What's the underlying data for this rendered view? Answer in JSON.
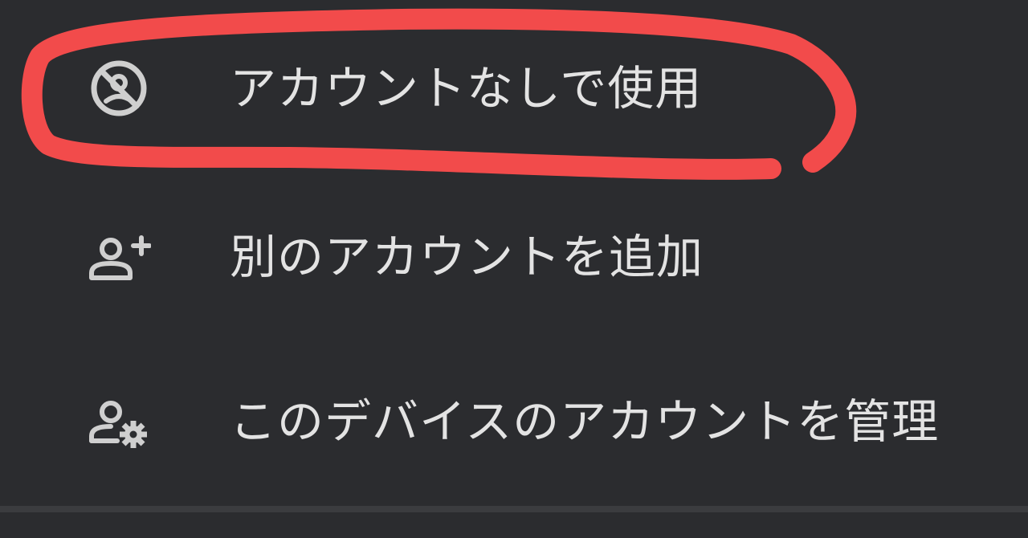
{
  "menu": {
    "items": [
      {
        "icon": "no-account-icon",
        "label": "アカウントなしで使用"
      },
      {
        "icon": "person-add-icon",
        "label": "別のアカウントを追加"
      },
      {
        "icon": "manage-accounts-icon",
        "label": "このデバイスのアカウントを管理"
      }
    ]
  },
  "colors": {
    "background": "#2b2c2f",
    "text": "#e3e3e3",
    "icon": "#cfcfcf",
    "annotation_highlight": "#f24b4b",
    "divider": "#3b3c3f"
  }
}
